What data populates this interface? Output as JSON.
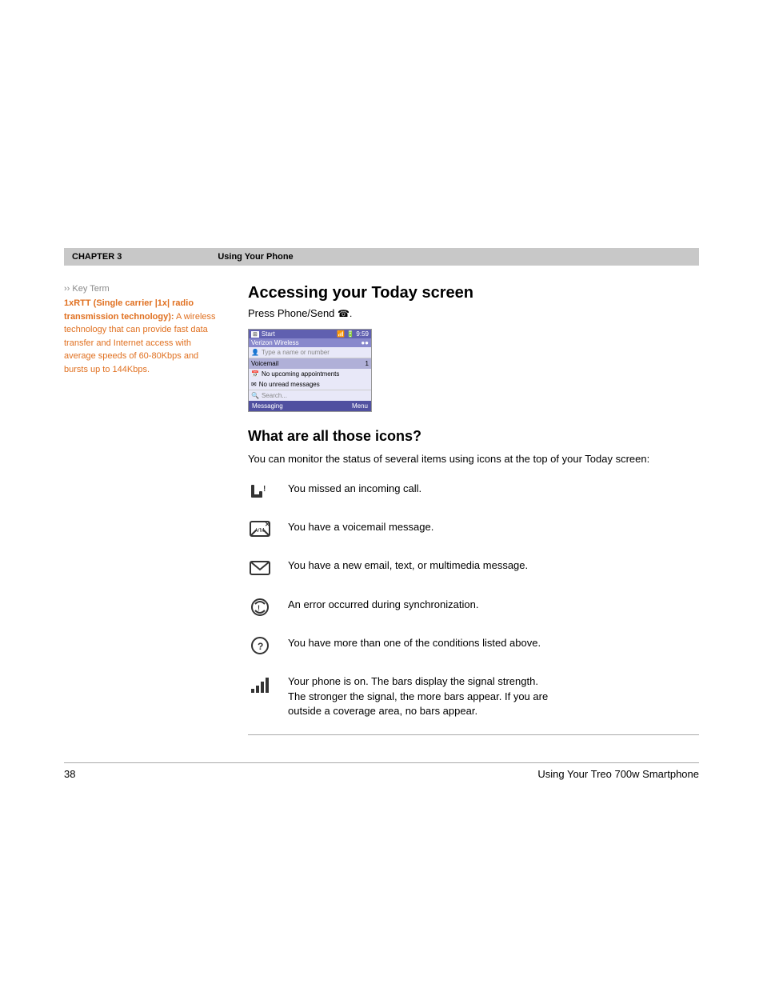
{
  "chapter": {
    "label": "CHAPTER 3",
    "title": "Using Your Phone"
  },
  "sidebar": {
    "key_term_header": "Key Term",
    "key_term_title": "1xRTT (Single carrier |1x| radio transmission technology):",
    "key_term_body": "A wireless technology that can provide fast data transfer and Internet access with average speeds of 60-80Kbps and bursts up to 144Kbps."
  },
  "section1": {
    "title": "Accessing your Today screen",
    "intro": "Press Phone/Send"
  },
  "phone_screen": {
    "titlebar": {
      "start": "Start",
      "time": "9:59"
    },
    "status_row": "Verizon Wireless",
    "type_row": "Type a name or number",
    "voicemail": "Voicemail",
    "voicemail_num": "1",
    "appointments": "No upcoming appointments",
    "messages": "No unread messages",
    "search": "Search...",
    "bottom_left": "Messaging",
    "bottom_right": "Menu"
  },
  "section2": {
    "title": "What are all those icons?",
    "intro": "You can monitor the status of several items using icons at the top of your Today screen:",
    "icons": [
      {
        "symbol": "📵",
        "unicode": "📵",
        "description": "You missed an incoming call."
      },
      {
        "symbol": "📳",
        "unicode": "☎",
        "description": "You have a voicemail message."
      },
      {
        "symbol": "✉",
        "unicode": "✉",
        "description": "You have a new email, text, or multimedia message."
      },
      {
        "symbol": "🔄",
        "unicode": "⟳",
        "description": "An error occurred during synchronization."
      },
      {
        "symbol": "💬",
        "unicode": "⁉",
        "description": "You have more than one of the conditions listed above."
      },
      {
        "symbol": "📶",
        "unicode": "📶",
        "description": "Your phone is on. The bars display the signal strength.\nThe stronger the signal, the more bars appear. If you are\noutside a coverage area, no bars appear."
      }
    ]
  },
  "footer": {
    "page_number": "38",
    "title": "Using Your Treo 700w Smartphone"
  }
}
